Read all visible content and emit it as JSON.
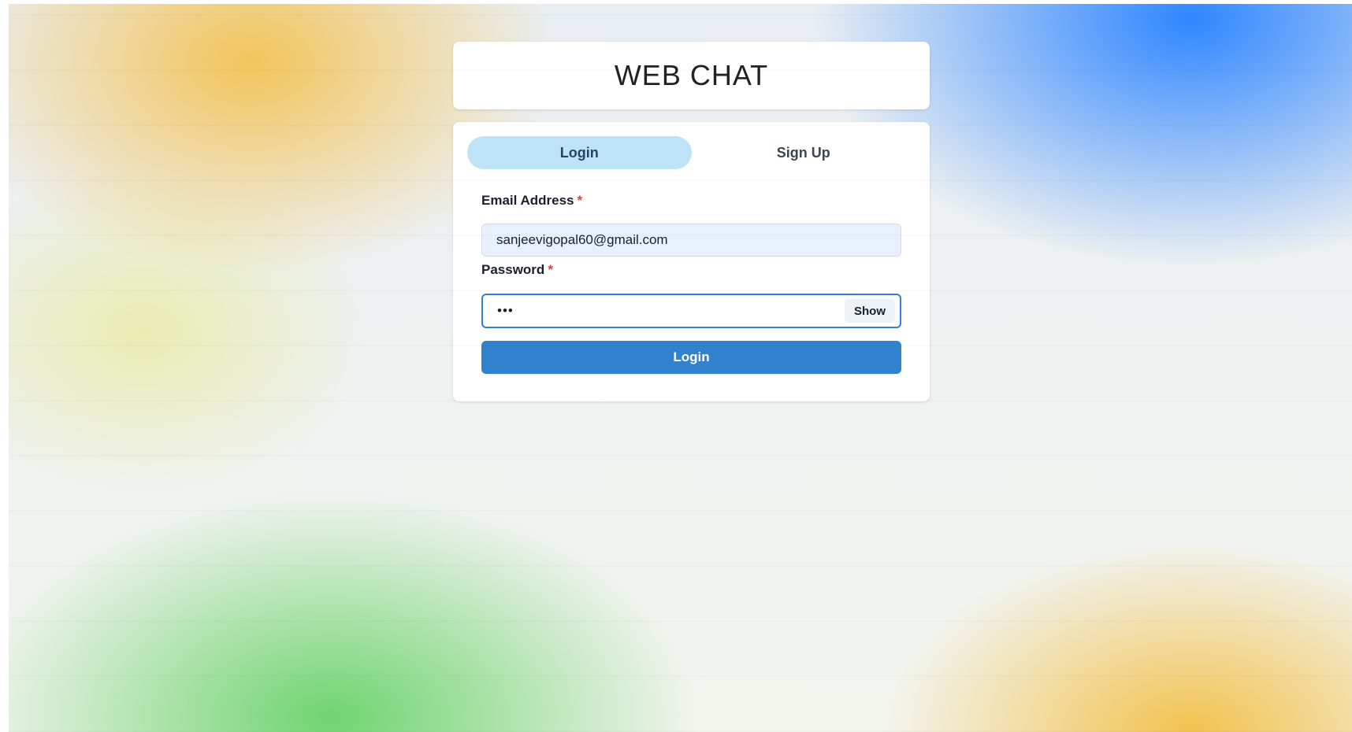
{
  "app": {
    "title": "WEB CHAT"
  },
  "tabs": [
    {
      "label": "Login",
      "active": true
    },
    {
      "label": "Sign Up",
      "active": false
    }
  ],
  "form": {
    "email_label": "Email Address",
    "email_value": "sanjeevigopal60@gmail.com",
    "password_label": "Password",
    "password_value": "•••",
    "required_marker": "*",
    "show_label": "Show",
    "submit_label": "Login"
  },
  "colors": {
    "accent": "#3182ce",
    "active_tab_bg": "#bee3f8",
    "required": "#e53e3e"
  }
}
